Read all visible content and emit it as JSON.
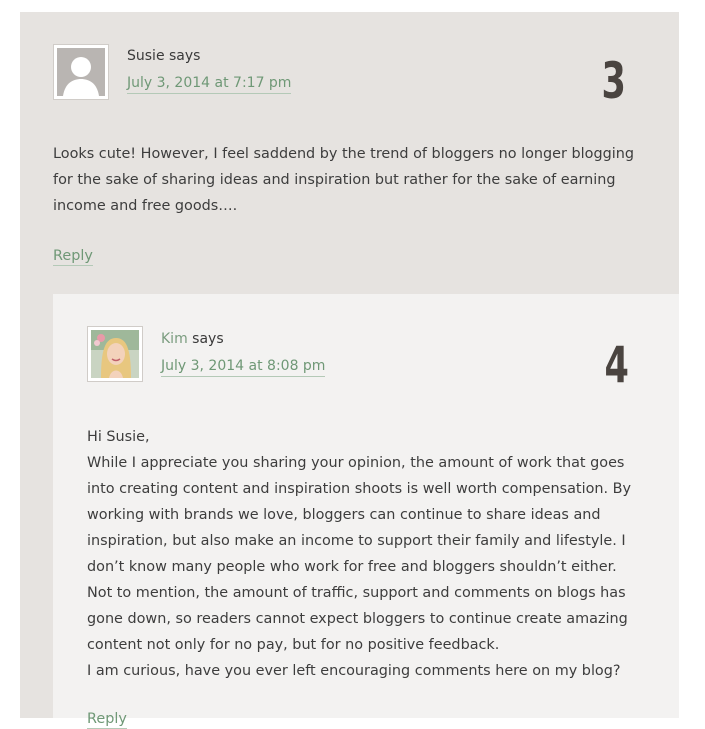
{
  "comments": [
    {
      "author": "Susie",
      "says": "says",
      "date": "July 3, 2014 at 7:17 pm",
      "number": "3",
      "paragraphs": [
        "Looks cute! However, I feel saddend by the trend of bloggers no longer blogging for the sake of sharing ideas and inspiration but rather for the sake of earning income and free goods…."
      ],
      "reply": "Reply",
      "avatar": "default-person-icon"
    },
    {
      "author": "Kim",
      "says": "says",
      "date": "July 3, 2014 at 8:08 pm",
      "number": "4",
      "paragraphs": [
        "Hi Susie,",
        "While I appreciate you sharing your opinion, the amount of work that goes into creating content and inspiration shoots is well worth compensation. By working with brands we love, bloggers can continue to share ideas and inspiration, but also make an income to support their family and lifestyle. I don’t know many people who work for free and bloggers shouldn’t either.",
        "Not to mention, the amount of traffic, support and comments on blogs has gone down, so readers cannot expect bloggers to continue create amazing content not only for no pay, but for no positive feedback.",
        "I am curious, have you ever left encouraging comments here on my blog?"
      ],
      "reply": "Reply",
      "avatar": "user-photo"
    }
  ],
  "colors": {
    "parent_bg": "#e6e3e0",
    "child_bg": "#f3f2f1",
    "link": "#6f9876",
    "number": "#4a4440"
  }
}
